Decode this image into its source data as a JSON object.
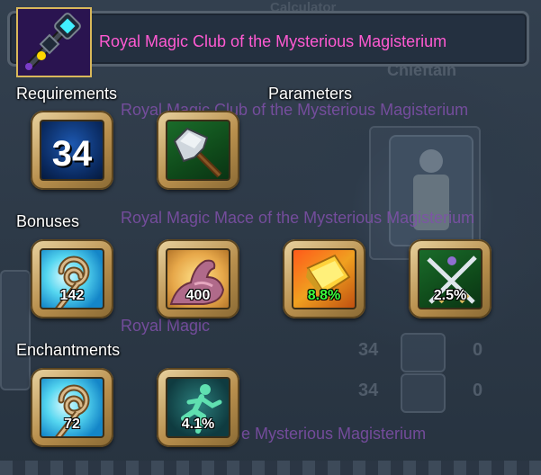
{
  "item": {
    "name": "Royal Magic Club of the Mysterious Magisterium",
    "name_color": "#ff5ad2",
    "icon": "magic-club-icon"
  },
  "sections": {
    "requirements": "Requirements",
    "parameters": "Parameters",
    "bonuses": "Bonuses",
    "enchantments": "Enchantments"
  },
  "requirements": [
    {
      "icon": "level-icon",
      "value": "34"
    },
    {
      "icon": "hammer-weapon-icon"
    }
  ],
  "bonuses": [
    {
      "icon": "magic-swirl-icon",
      "value": "142"
    },
    {
      "icon": "strength-arm-icon",
      "value": "400"
    },
    {
      "icon": "gold-book-icon",
      "value": "8.8%",
      "color": "#3cff3c"
    },
    {
      "icon": "crossed-swords-icon",
      "value": "2.5%"
    }
  ],
  "enchantments": [
    {
      "icon": "magic-swirl-icon",
      "value": "72"
    },
    {
      "icon": "running-figure-icon",
      "value": "4.1%"
    }
  ],
  "background": {
    "ghost_texts": [
      "Royal Magic Club of the Mysterious Magisterium",
      "Royal Magic Mace of the Mysterious Magisterium",
      "Royal Magic",
      "e Mysterious Magisterium"
    ],
    "words": [
      "Calculator",
      "Chieftain"
    ],
    "numbers": [
      "34",
      "0",
      "34",
      "0"
    ]
  }
}
